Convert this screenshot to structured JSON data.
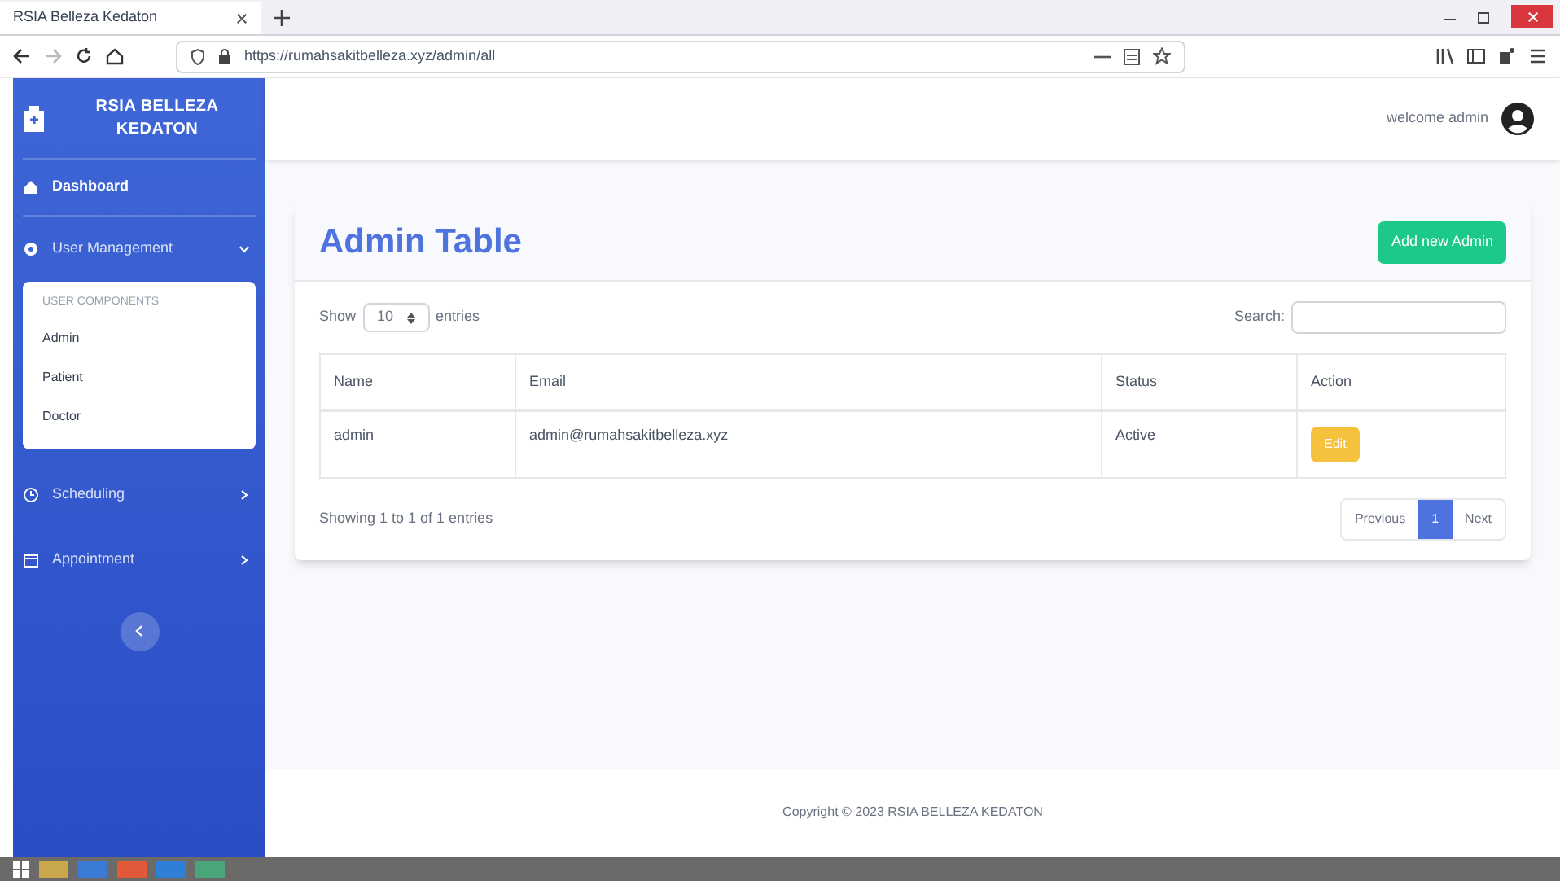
{
  "browser": {
    "tab_title": "RSIA Belleza Kedaton",
    "url": "https://rumahsakitbelleza.xyz/admin/all"
  },
  "brand": {
    "line1": "RSIA BELLEZA",
    "line2": "KEDATON"
  },
  "topbar": {
    "welcome": "welcome admin"
  },
  "sidebar": {
    "items": [
      {
        "label": "Dashboard"
      },
      {
        "label": "User Management",
        "expanded": true,
        "section": "USER COMPONENTS",
        "children": [
          {
            "label": "Admin"
          },
          {
            "label": "Patient"
          },
          {
            "label": "Doctor"
          }
        ]
      },
      {
        "label": "Scheduling",
        "expanded": false
      },
      {
        "label": "Appointment",
        "expanded": false
      }
    ]
  },
  "card": {
    "title": "Admin Table",
    "add_button": "Add new Admin",
    "show_label": "Show",
    "page_size": "10",
    "entries_label": "entries",
    "search_label": "Search:",
    "columns": [
      "Name",
      "Email",
      "Status",
      "Action"
    ],
    "rows": [
      {
        "name": "admin",
        "email": "admin@rumahsakitbelleza.xyz",
        "status": "Active",
        "action": "Edit"
      }
    ],
    "info": "Showing 1 to 1 of 1 entries",
    "pagination": [
      {
        "label": "Previous",
        "selected": false
      },
      {
        "label": "1",
        "selected": true
      },
      {
        "label": "Next",
        "selected": false
      }
    ]
  },
  "footer": {
    "copyright": "Copyright © 2023 RSIA BELLEZA KEDATON"
  }
}
